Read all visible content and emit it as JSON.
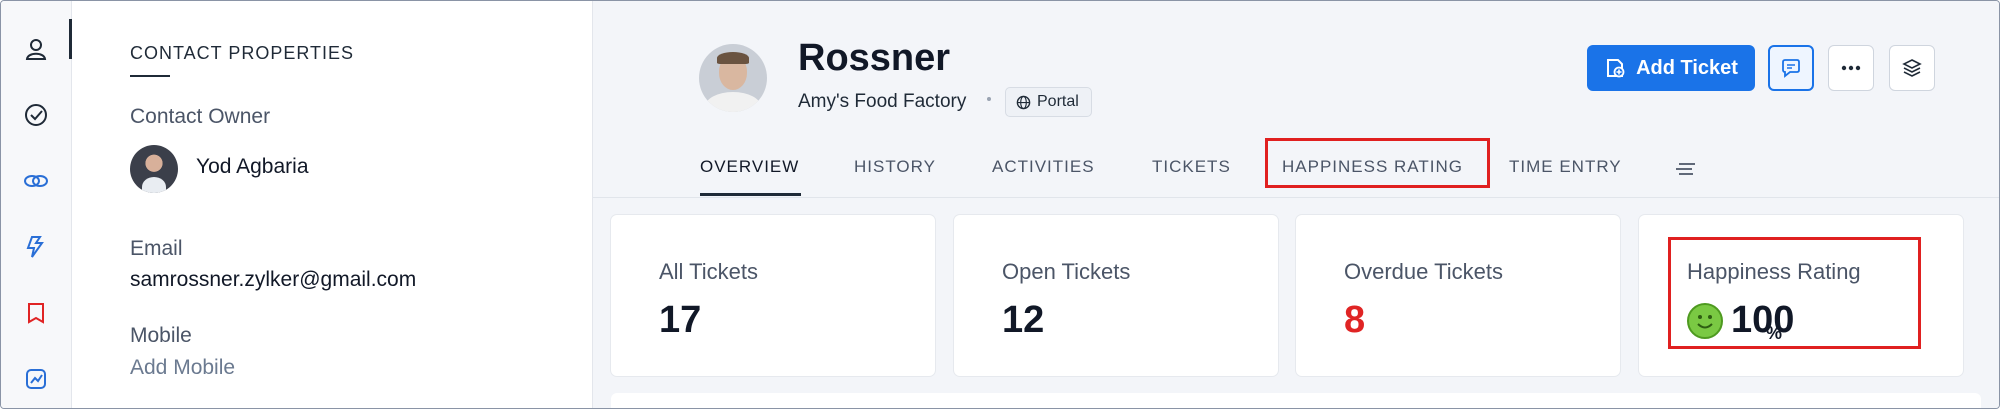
{
  "rail": {
    "items": [
      {
        "icon": "contact-icon"
      },
      {
        "icon": "check-circle-icon"
      },
      {
        "icon": "link-icon"
      },
      {
        "icon": "crm-icon"
      },
      {
        "icon": "bookmark-icon"
      },
      {
        "icon": "analytics-icon"
      }
    ]
  },
  "props": {
    "heading": "CONTACT PROPERTIES",
    "owner_label": "Contact Owner",
    "owner_name": "Yod Agbaria",
    "email_label": "Email",
    "email_value": "samrossner.zylker@gmail.com",
    "mobile_label": "Mobile",
    "mobile_value": "Add Mobile"
  },
  "header": {
    "name": "Rossner",
    "company": "Amy's Food Factory",
    "portal_label": "Portal",
    "add_ticket_label": "Add Ticket"
  },
  "tabs": [
    {
      "label": "OVERVIEW",
      "active": true
    },
    {
      "label": "HISTORY",
      "active": false
    },
    {
      "label": "ACTIVITIES",
      "active": false
    },
    {
      "label": "TICKETS",
      "active": false
    },
    {
      "label": "HAPPINESS RATING",
      "active": false
    },
    {
      "label": "TIME ENTRY",
      "active": false
    }
  ],
  "cards": [
    {
      "label": "All Tickets",
      "value": "17"
    },
    {
      "label": "Open Tickets",
      "value": "12"
    },
    {
      "label": "Overdue Tickets",
      "value": "8"
    },
    {
      "label": "Happiness Rating",
      "value": "100",
      "unit": "%"
    }
  ],
  "colors": {
    "accent": "#1a73e8",
    "overdue": "#e02424",
    "highlight": "#e02020",
    "smile": "#7ac943"
  }
}
